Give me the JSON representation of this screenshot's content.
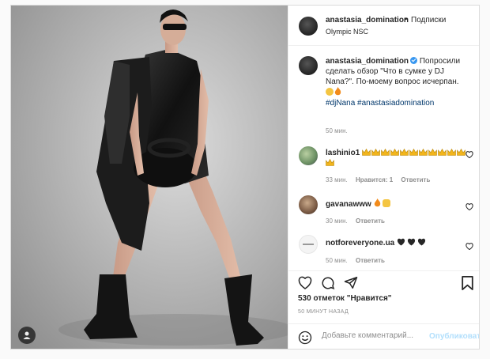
{
  "post": {
    "username": "anastasia_domination",
    "separator": "•",
    "follow_label": "Подписки",
    "location": "Olympic NSC"
  },
  "caption": {
    "username": "anastasia_domination",
    "text": "Попросили сделать обзор \"Что в сумке у DJ Nana?\". По-моему вопрос исчерпан.",
    "emojis": [
      "grinning-sweat-face",
      "fire"
    ],
    "hashtags": "#djNana #anastasiadomination",
    "time": "50 мин."
  },
  "comments": [
    {
      "username": "lashinio1",
      "emoji": "crown",
      "emoji_count": 12,
      "time": "33 мин.",
      "likes": "Нравится: 1",
      "reply": "Ответить"
    },
    {
      "username": "gavanawww",
      "emojis": [
        "fire",
        "thumbs-up"
      ],
      "time": "30 мин.",
      "reply": "Ответить"
    },
    {
      "username": "notforeveryone.ua",
      "emoji": "black-heart",
      "emoji_count": 3,
      "time": "50 мин.",
      "reply": "Ответить"
    }
  ],
  "actions": {
    "likes_count": "530 отметок \"Нравится\"",
    "posted_ago": "50 МИНУТ НАЗАД"
  },
  "add_comment": {
    "placeholder": "Добавьте комментарий...",
    "publish_label": "Опубликовать"
  },
  "colors": {
    "link": "#00376b",
    "verified": "#3897f0",
    "publish_disabled": "#b2dffc",
    "muted": "#8e8e8e"
  }
}
